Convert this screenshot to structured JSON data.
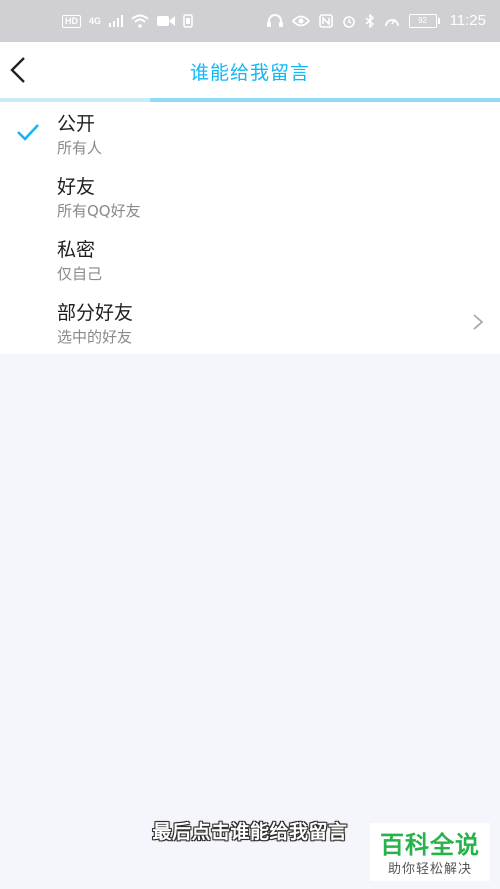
{
  "status_bar": {
    "hd": "HD",
    "network": "4G",
    "battery": "92",
    "time": "11:25"
  },
  "header": {
    "title": "谁能给我留言",
    "back_icon": "chevron-left-icon",
    "accent_color": "#12b7f5"
  },
  "progress": {
    "value_fraction": 0.3
  },
  "options": [
    {
      "title": "公开",
      "subtitle": "所有人",
      "selected": true
    },
    {
      "title": "好友",
      "subtitle": "所有QQ好友",
      "selected": false
    },
    {
      "title": "私密",
      "subtitle": "仅自己",
      "selected": false
    },
    {
      "title": "部分好友",
      "subtitle": "选中的好友",
      "selected": false,
      "has_arrow": true
    }
  ],
  "caption": "最后点击谁能给我留言",
  "watermark": {
    "title": "百科全说",
    "subtitle": "助你轻松解决"
  }
}
